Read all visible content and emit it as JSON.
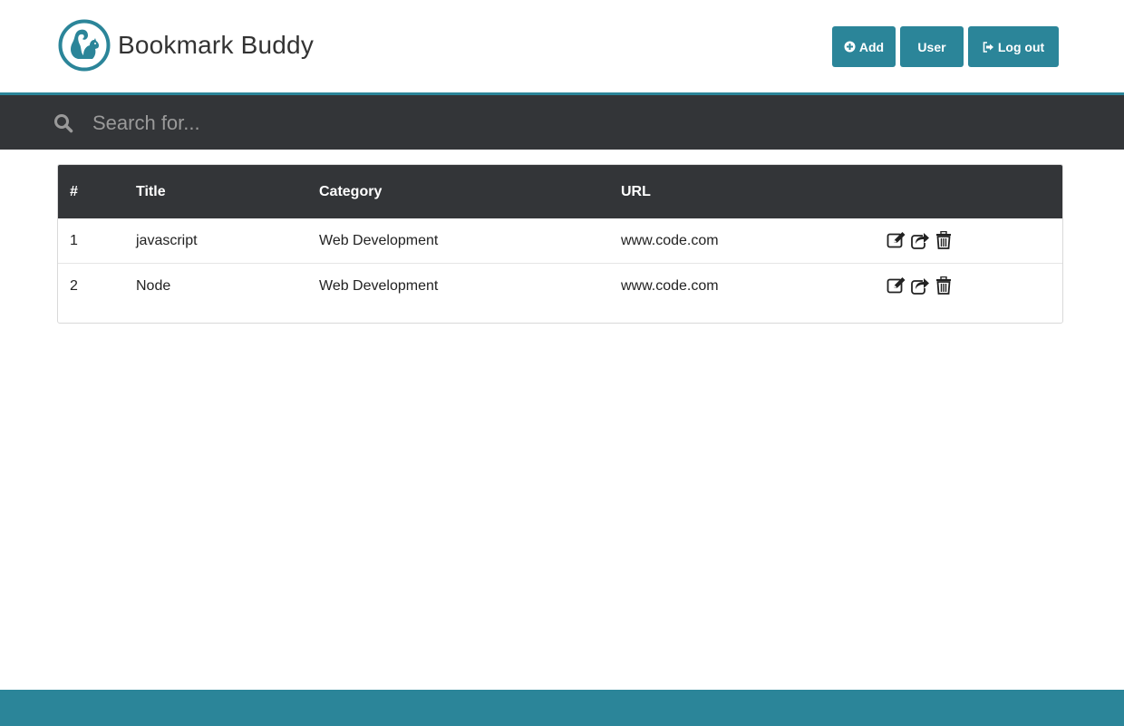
{
  "app": {
    "name": "Bookmark Buddy"
  },
  "header": {
    "add_label": "Add",
    "user_label": "User",
    "logout_label": "Log out"
  },
  "search": {
    "placeholder": "Search for..."
  },
  "table": {
    "columns": [
      "#",
      "Title",
      "Category",
      "URL"
    ],
    "rows": [
      {
        "num": "1",
        "title": "javascript",
        "category": "Web Development",
        "url": "www.code.com"
      },
      {
        "num": "2",
        "title": "Node",
        "category": "Web Development",
        "url": "www.code.com"
      }
    ]
  },
  "colors": {
    "accent": "#2b8599",
    "dark_bar": "#333538"
  },
  "icons": {
    "logo": "squirrel-logo-icon",
    "add": "plus-circle-icon",
    "logout": "sign-out-icon",
    "search": "search-icon",
    "row_actions": [
      "edit-icon",
      "share-icon",
      "trash-icon"
    ]
  }
}
